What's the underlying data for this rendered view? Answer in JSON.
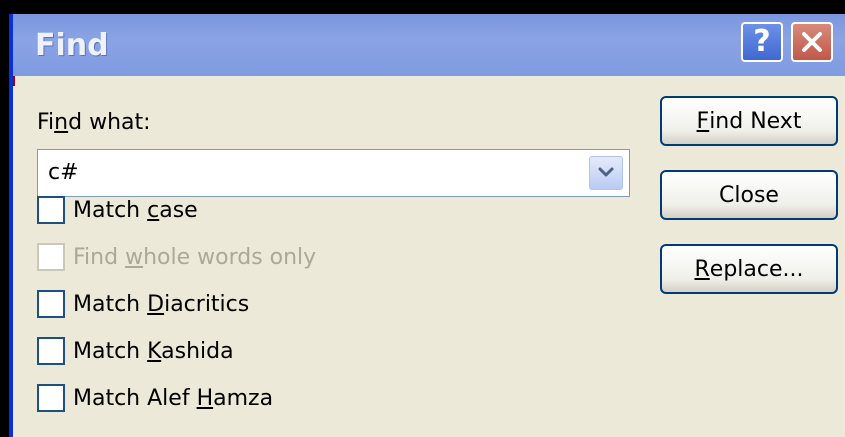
{
  "window": {
    "title": "Find",
    "help_glyph": "?"
  },
  "find_what": {
    "label_pre": "Fi",
    "label_u": "n",
    "label_post": "d what:",
    "value": "c#"
  },
  "options": [
    {
      "pre": "Match ",
      "u": "c",
      "post": "ase",
      "checked": false,
      "enabled": true
    },
    {
      "pre": "Find ",
      "u": "w",
      "post": "hole words only",
      "checked": false,
      "enabled": false
    },
    {
      "pre": "Match ",
      "u": "D",
      "post": "iacritics",
      "checked": false,
      "enabled": true
    },
    {
      "pre": "Match ",
      "u": "K",
      "post": "ashida",
      "checked": false,
      "enabled": true
    },
    {
      "pre": "Match Alef ",
      "u": "H",
      "post": "amza",
      "checked": false,
      "enabled": true
    }
  ],
  "buttons": {
    "find_next": {
      "u": "F",
      "post": "ind Next"
    },
    "close": {
      "label": "Close"
    },
    "replace": {
      "u": "R",
      "post": "eplace..."
    }
  },
  "colors": {
    "titlebar": "#7F9BE1",
    "dialog_bg": "#ECE9D8",
    "button_border": "#003C74"
  }
}
